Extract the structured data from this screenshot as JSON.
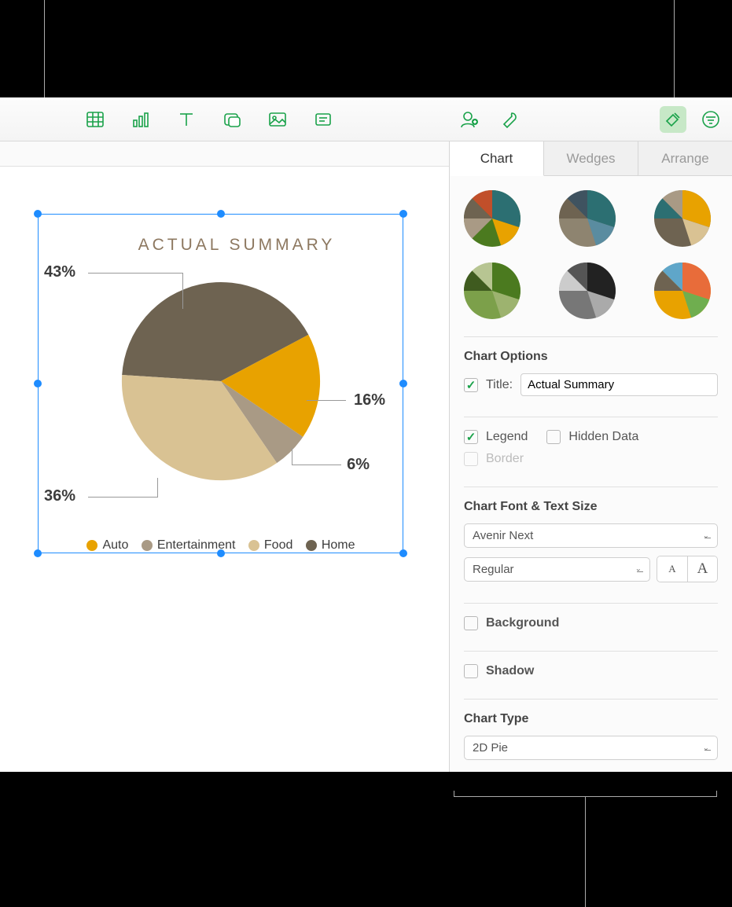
{
  "toolbar": {
    "icons": [
      "table-icon",
      "chart-icon",
      "text-icon",
      "shape-icon",
      "media-icon",
      "comment-icon",
      "collab-icon",
      "wrench-icon",
      "format-icon",
      "filter-icon"
    ]
  },
  "chart_data": {
    "type": "pie",
    "title": "ACTUAL SUMMARY",
    "categories": [
      "Auto",
      "Entertainment",
      "Food",
      "Home"
    ],
    "values": [
      16,
      6,
      36,
      43
    ],
    "colors": [
      "#e8a200",
      "#a99a85",
      "#d9c293",
      "#6e6351"
    ],
    "labels_pct": {
      "auto": "16%",
      "entertainment": "6%",
      "food": "36%",
      "home": "43%"
    }
  },
  "inspector": {
    "tabs": {
      "chart": "Chart",
      "wedges": "Wedges",
      "arrange": "Arrange"
    },
    "chart_options_head": "Chart Options",
    "title_label": "Title:",
    "title_value": "Actual Summary",
    "legend_label": "Legend",
    "hidden_data_label": "Hidden Data",
    "border_label": "Border",
    "font_head": "Chart Font & Text Size",
    "font_family": "Avenir Next",
    "font_weight": "Regular",
    "size_small": "A",
    "size_large": "A",
    "background_label": "Background",
    "shadow_label": "Shadow",
    "chart_type_head": "Chart Type",
    "chart_type_value": "2D Pie"
  }
}
